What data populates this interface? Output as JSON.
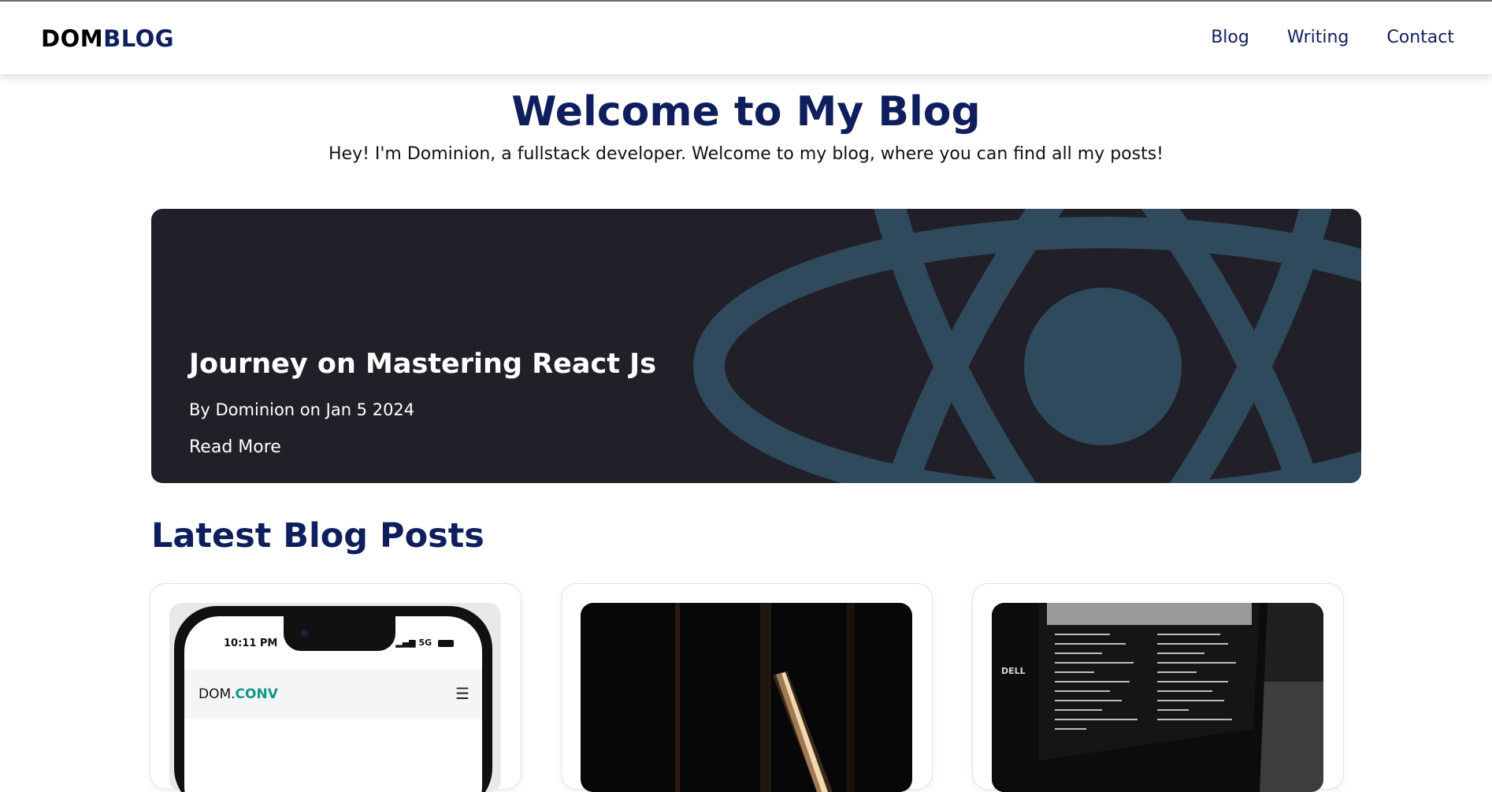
{
  "header": {
    "logo_part1": "DOM",
    "logo_part2": "BLOG",
    "nav": [
      "Blog",
      "Writing",
      "Contact"
    ]
  },
  "hero": {
    "title": "Welcome to My Blog",
    "subtitle": "Hey! I'm Dominion, a fullstack developer. Welcome to my blog, where you can find all my posts!"
  },
  "featured": {
    "title": "Journey on Mastering React Js",
    "meta": "By Dominion on Jan 5 2024",
    "read_more": "Read More",
    "background_icon": "react-atom-icon",
    "colors": {
      "background": "#212028",
      "atom": "#2f4a5c"
    }
  },
  "latest": {
    "title": "Latest Blog Posts",
    "cards": [
      {
        "thumb": "phone-mockup",
        "phone_time": "10:11 PM",
        "phone_signal": "5G",
        "app_name_part1": "DOM.",
        "app_name_part2": "CONV",
        "menu_icon": "hamburger-icon"
      },
      {
        "thumb": "desk-lamp-dark"
      },
      {
        "thumb": "laptop-code-dark",
        "laptop_brand": "DELL"
      }
    ]
  },
  "colors": {
    "brand_navy": "#0f1f5e",
    "accent_teal": "#13958a"
  }
}
